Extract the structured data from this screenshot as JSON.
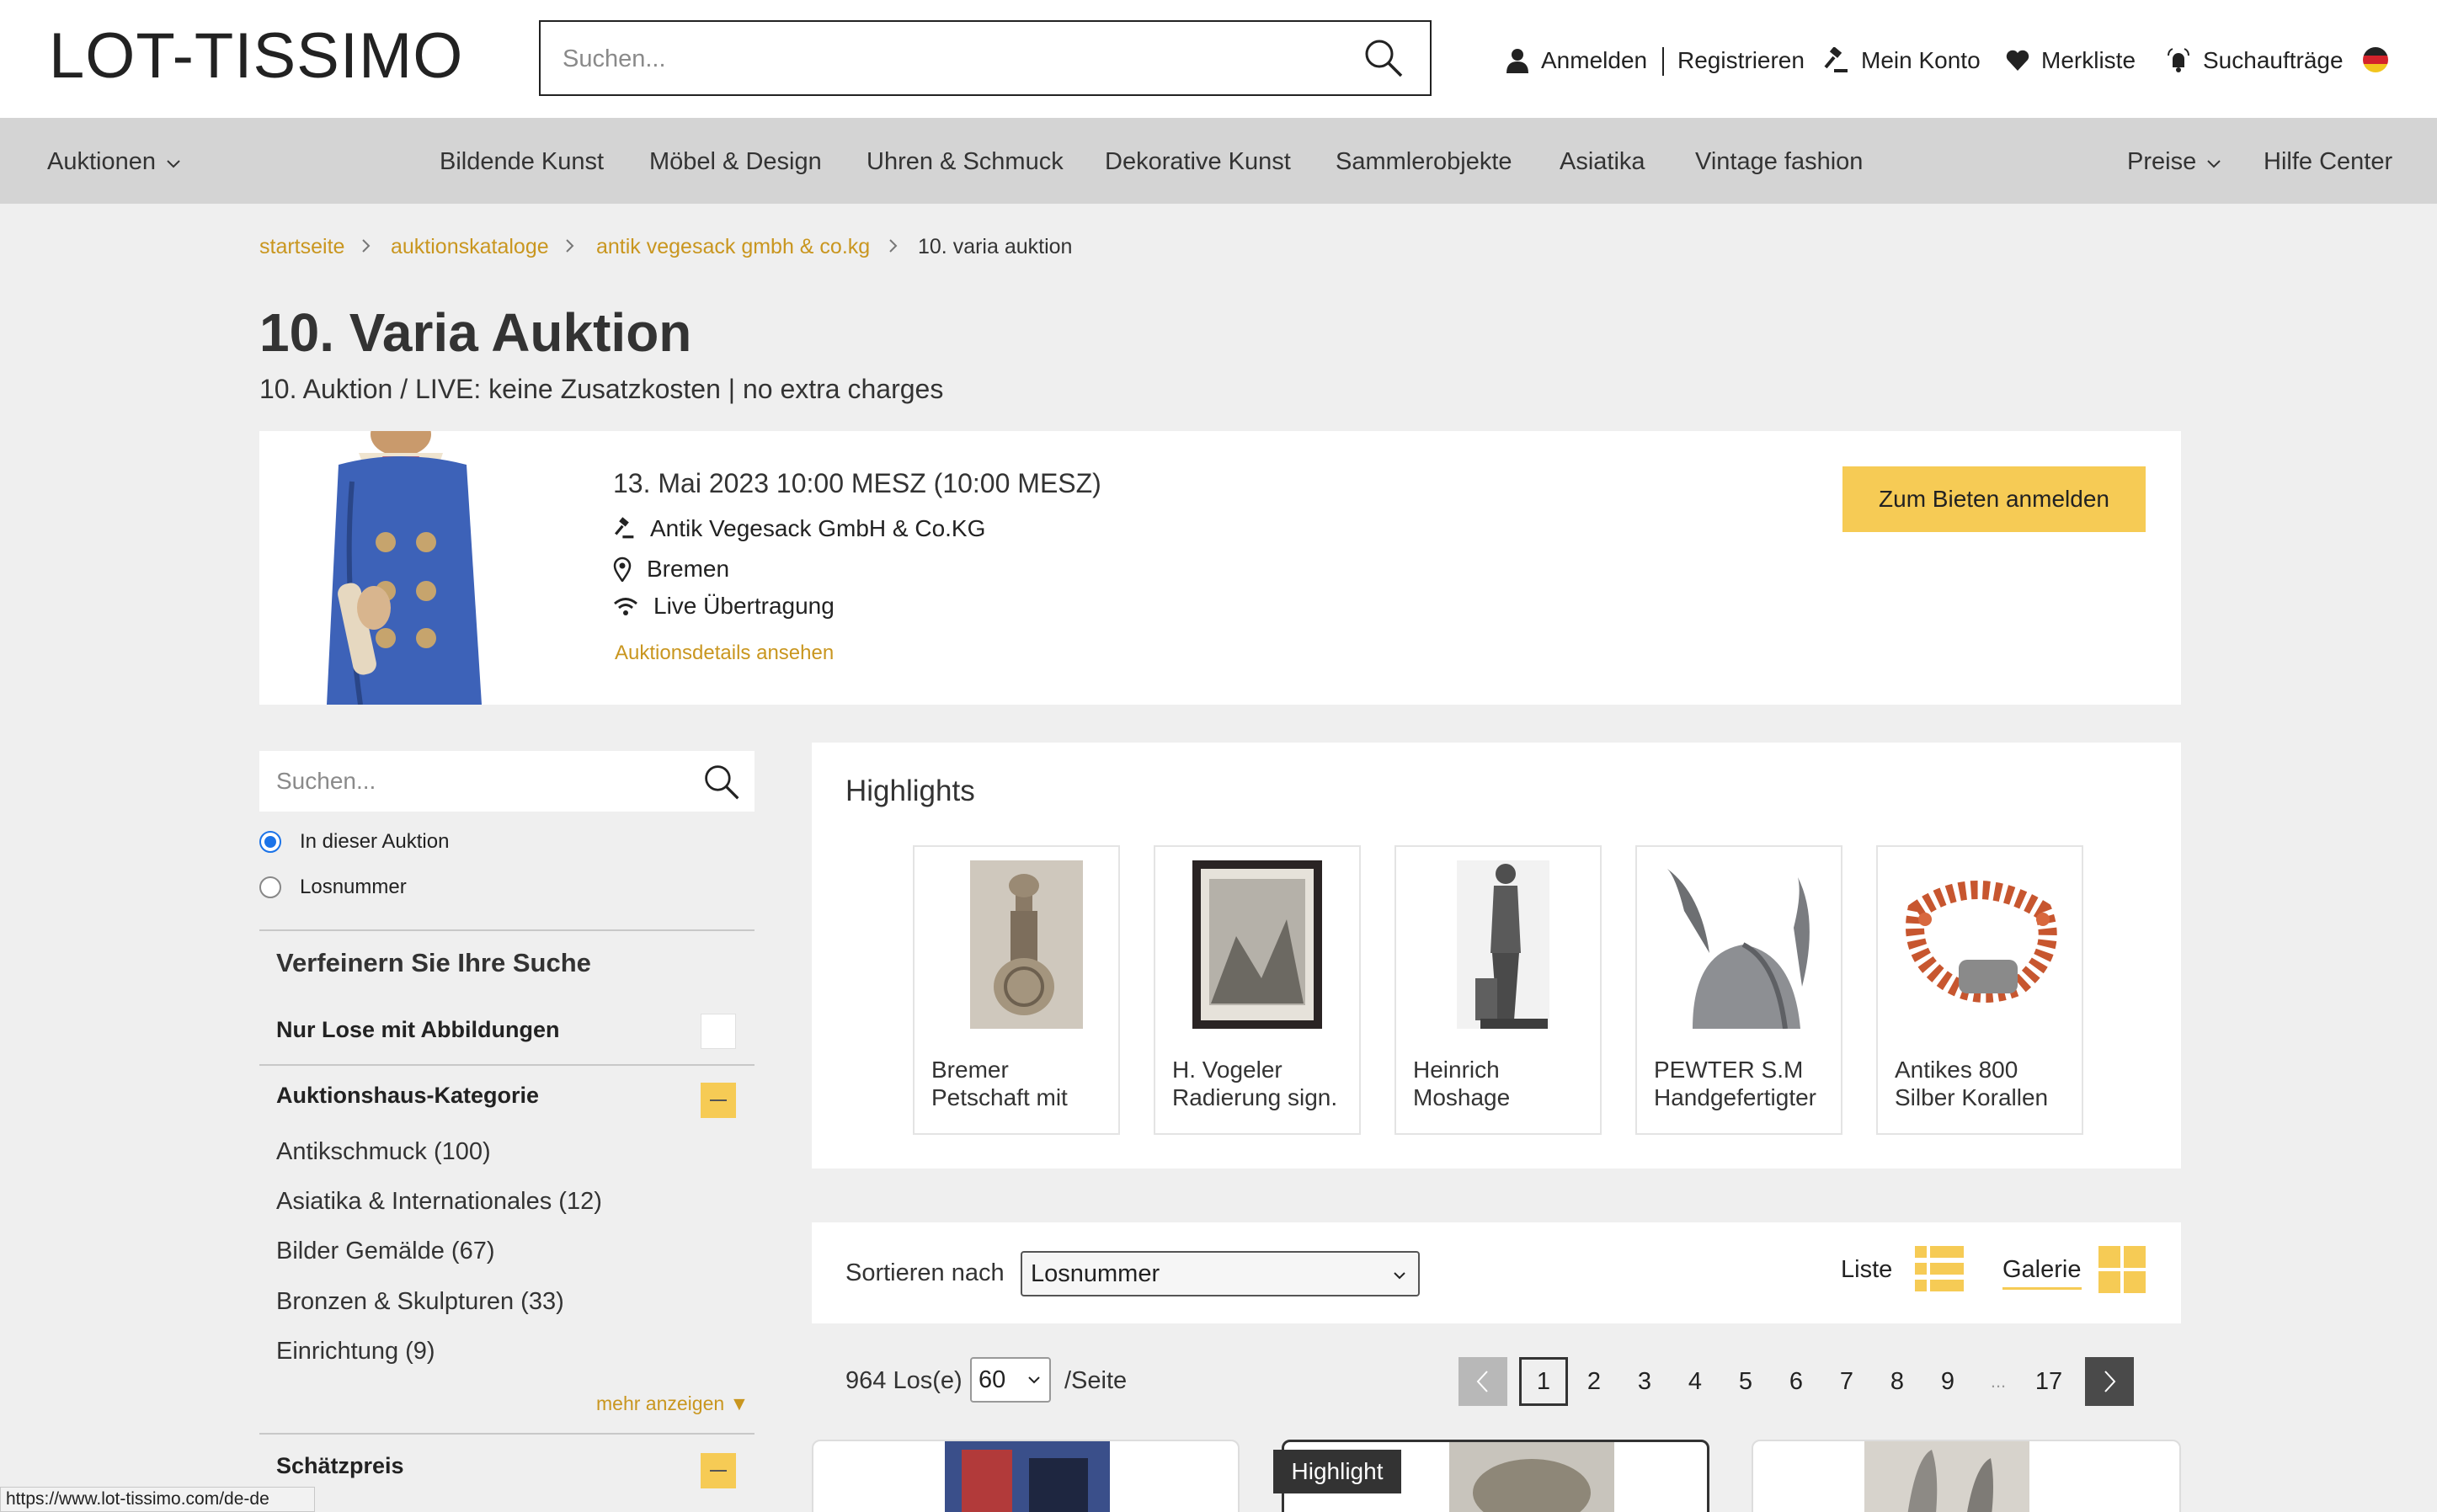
{
  "header": {
    "logo": "LOT-TISSIMO",
    "search_placeholder": "Suchen...",
    "login": "Anmelden",
    "register": "Registrieren",
    "account": "Mein Konto",
    "watchlist": "Merkliste",
    "search_orders": "Suchaufträge"
  },
  "nav": {
    "auctions": "Auktionen",
    "items": [
      "Bildende Kunst",
      "Möbel & Design",
      "Uhren & Schmuck",
      "Dekorative Kunst",
      "Sammlerobjekte",
      "Asiatika",
      "Vintage fashion"
    ],
    "prices": "Preise",
    "help": "Hilfe Center"
  },
  "breadcrumb": [
    "startseite",
    "auktionskataloge",
    "antik vegesack gmbh & co.kg",
    "10. varia auktion"
  ],
  "page": {
    "title": "10. Varia Auktion",
    "subtitle": "10. Auktion / LIVE: keine Zusatzkosten | no extra charges"
  },
  "auction": {
    "date": "13. Mai 2023 10:00 MESZ (10:00 MESZ)",
    "house": "Antik Vegesack GmbH & Co.KG",
    "location": "Bremen",
    "mode": "Live Übertragung",
    "details_link": "Auktionsdetails ansehen",
    "bid_button": "Zum Bieten anmelden"
  },
  "sidebar": {
    "search_placeholder": "Suchen...",
    "radio_in_auction": "In dieser Auktion",
    "radio_lot_number": "Losnummer",
    "refine_title": "Verfeinern Sie Ihre Suche",
    "only_images": "Nur Lose mit Abbildungen",
    "category_title": "Auktionshaus-Kategorie",
    "categories": [
      "Antikschmuck (100)",
      "Asiatika & Internationales (12)",
      "Bilder Gemälde (67)",
      "Bronzen & Skulpturen (33)",
      "Einrichtung (9)"
    ],
    "show_more": "mehr anzeigen ▼",
    "estimate_title": "Schätzpreis"
  },
  "highlights": {
    "title": "Highlights",
    "items": [
      {
        "line1": "Bremer",
        "line2": "Petschaft mit"
      },
      {
        "line1": "H. Vogeler",
        "line2": "Radierung sign."
      },
      {
        "line1": "Heinrich",
        "line2": "Moshage"
      },
      {
        "line1": "PEWTER S.M",
        "line2": "Handgefertigter"
      },
      {
        "line1": "Antikes 800",
        "line2": "Silber Korallen"
      }
    ]
  },
  "sort": {
    "label": "Sortieren nach",
    "value": "Losnummer",
    "list": "Liste",
    "gallery": "Galerie"
  },
  "pagination": {
    "count": "964 Los(e)",
    "per_page": "60",
    "per_page_suffix": "/Seite",
    "pages": [
      "1",
      "2",
      "3",
      "4",
      "5",
      "6",
      "7",
      "8",
      "9",
      "...",
      "17"
    ]
  },
  "lots": {
    "badge": "Highlight"
  },
  "status_url": "https://www.lot-tissimo.com/de-de",
  "colors": {
    "accent": "#f6cb55",
    "link": "#c9961f",
    "nav_bg": "#d4d4d4",
    "page_bg": "#efefef"
  }
}
